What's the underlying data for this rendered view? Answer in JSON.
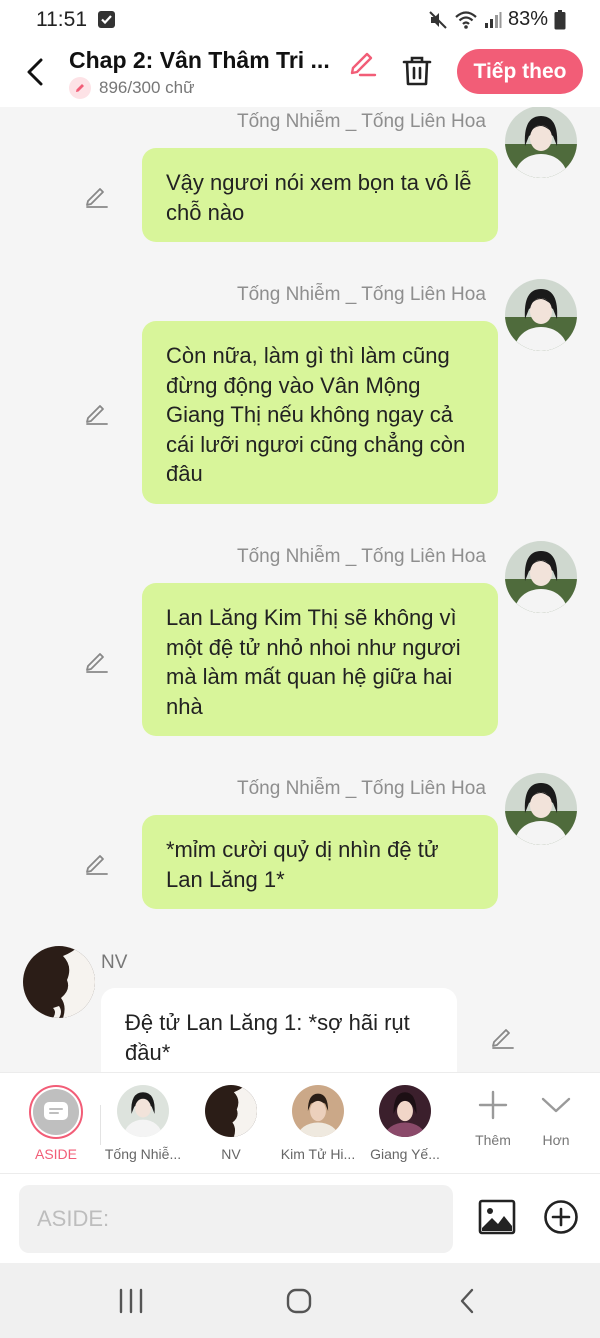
{
  "status_bar": {
    "time": "11:51",
    "battery": "83%"
  },
  "header": {
    "title": "Chap 2: Vân Thâm Tri ...",
    "word_count": "896/300 chữ",
    "next_label": "Tiếp theo"
  },
  "messages": [
    {
      "sender": "Tống Nhiễm _ Tống Liên Hoa",
      "text": "Vậy ngươi nói xem bọn ta vô lễ chỗ nào"
    },
    {
      "sender": "Tống Nhiễm _ Tống Liên Hoa",
      "text": "Còn nữa, làm gì thì làm cũng đừng động vào Vân Mộng Giang Thị nếu không ngay cả cái lưỡi ngươi cũng chẳng còn đâu"
    },
    {
      "sender": "Tống Nhiễm _ Tống Liên Hoa",
      "text": "Lan Lăng Kim Thị sẽ không vì một đệ tử nhỏ nhoi như ngươi mà làm mất quan hệ giữa hai nhà"
    },
    {
      "sender": "Tống Nhiễm _ Tống Liên Hoa",
      "text": "*mỉm cười quỷ dị nhìn đệ tử Lan Lăng 1*"
    },
    {
      "sender": "NV",
      "text": "Đệ tử Lan Lăng 1: *sợ hãi rụt đầu*"
    }
  ],
  "characters": [
    {
      "label": "ASIDE"
    },
    {
      "label": "Tống Nhiễ..."
    },
    {
      "label": "NV"
    },
    {
      "label": "Kim Tử Hi..."
    },
    {
      "label": "Giang Yế..."
    }
  ],
  "tools": {
    "add_label": "Thêm",
    "more_label": "Hơn"
  },
  "input": {
    "placeholder": "ASIDE:"
  },
  "colors": {
    "accent": "#f25d77",
    "bubble_green": "#d8f59a",
    "background": "#f5f5f5"
  },
  "icons": [
    "back-arrow-icon",
    "edit-pencil-icon",
    "trash-icon",
    "image-icon",
    "plus-circle-icon",
    "plus-icon",
    "chevron-down-icon"
  ]
}
